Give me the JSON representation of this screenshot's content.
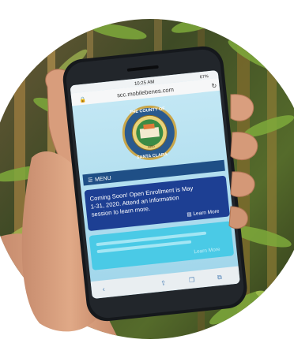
{
  "status_bar": {
    "time": "10:25 AM",
    "battery": "67%"
  },
  "browser": {
    "url": "scc.mobilebenes.com"
  },
  "seal": {
    "text_top": "THE COUNTY OF",
    "text_bottom": "SANTA CLARA",
    "year": "1850"
  },
  "menu": {
    "label": "MENU"
  },
  "notice": {
    "text_lines": [
      "Coming Soon! Open Enrollment is May",
      "1-31, 2020. Attend an information",
      "session to learn more."
    ],
    "link_label": "Learn More"
  },
  "secondary_card": {
    "link_label": "Learn More"
  },
  "colors": {
    "screen_bg": "#a9dcef",
    "menu_bar": "#1f4f86",
    "notice_card": "#1d3f93",
    "secondary_card": "#45c9e6",
    "phone_body": "#15181c"
  },
  "icons": [
    "lock-icon",
    "reload-icon",
    "menu-icon",
    "document-icon",
    "back-icon",
    "share-icon",
    "bookmarks-icon",
    "tabs-icon"
  ]
}
